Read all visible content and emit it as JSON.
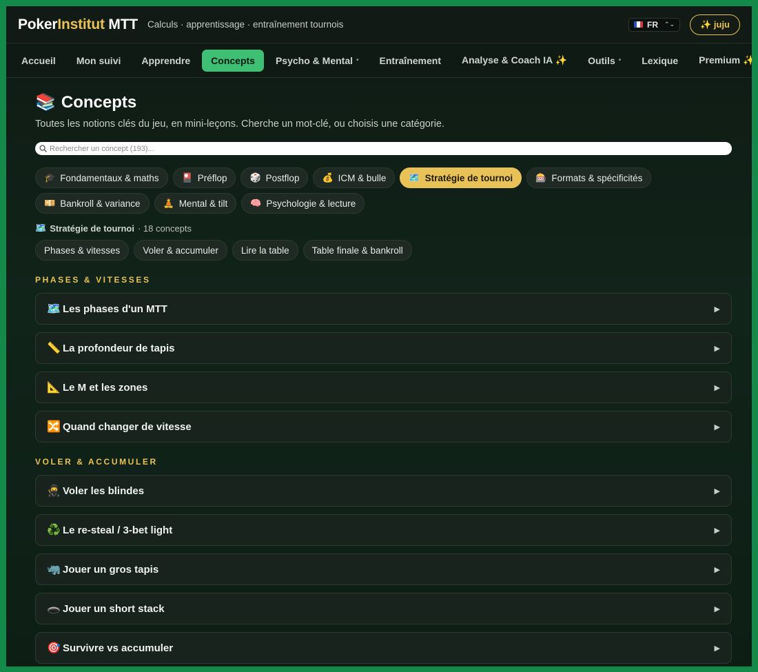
{
  "header": {
    "brand_part1": "Poker",
    "brand_part2": "Institut",
    "brand_part3": " MTT",
    "tagline": "Calculs · apprentissage · entraînement tournois",
    "language": "FR",
    "user_button": "✨ juju"
  },
  "nav": [
    {
      "label": "Accueil",
      "active": false,
      "dropdown": false
    },
    {
      "label": "Mon suivi",
      "active": false,
      "dropdown": false
    },
    {
      "label": "Apprendre",
      "active": false,
      "dropdown": false
    },
    {
      "label": "Concepts",
      "active": true,
      "dropdown": false
    },
    {
      "label": "Psycho & Mental",
      "active": false,
      "dropdown": true
    },
    {
      "label": "Entraînement",
      "active": false,
      "dropdown": false
    },
    {
      "label": "Analyse & Coach IA ✨",
      "active": false,
      "dropdown": false
    },
    {
      "label": "Outils",
      "active": false,
      "dropdown": true
    },
    {
      "label": "Lexique",
      "active": false,
      "dropdown": false
    },
    {
      "label": "Premium ✨",
      "active": false,
      "dropdown": false
    }
  ],
  "page": {
    "icon": "📚",
    "title": "Concepts",
    "subtitle": "Toutes les notions clés du jeu, en mini-leçons. Cherche un mot-clé, ou choisis une catégorie.",
    "search_placeholder": "Rechercher un concept (193)..."
  },
  "categories": [
    {
      "emoji": "🎓",
      "label": "Fondamentaux & maths",
      "active": false
    },
    {
      "emoji": "🎴",
      "label": "Préflop",
      "active": false
    },
    {
      "emoji": "🎲",
      "label": "Postflop",
      "active": false
    },
    {
      "emoji": "💰",
      "label": "ICM & bulle",
      "active": false
    },
    {
      "emoji": "🗺️",
      "label": "Stratégie de tournoi",
      "active": true
    },
    {
      "emoji": "🎰",
      "label": "Formats & spécificités",
      "active": false
    },
    {
      "emoji": "💴",
      "label": "Bankroll & variance",
      "active": false
    },
    {
      "emoji": "🧘",
      "label": "Mental & tilt",
      "active": false
    },
    {
      "emoji": "🧠",
      "label": "Psychologie & lecture",
      "active": false
    }
  ],
  "current_category": {
    "emoji": "🗺️",
    "name": "Stratégie de tournoi",
    "count": "· 18 concepts"
  },
  "subcategories": [
    "Phases & vitesses",
    "Voler & accumuler",
    "Lire la table",
    "Table finale & bankroll"
  ],
  "sections": [
    {
      "title": "Phases & vitesses",
      "concepts": [
        {
          "emoji": "🗺️",
          "title": "Les phases d'un MTT"
        },
        {
          "emoji": "📏",
          "title": "La profondeur de tapis"
        },
        {
          "emoji": "📐",
          "title": "Le M et les zones"
        },
        {
          "emoji": "🔀",
          "title": "Quand changer de vitesse"
        }
      ]
    },
    {
      "title": "Voler & accumuler",
      "concepts": [
        {
          "emoji": "🥷",
          "title": "Voler les blindes"
        },
        {
          "emoji": "♻️",
          "title": "Le re-steal / 3-bet light"
        },
        {
          "emoji": "🦏",
          "title": "Jouer un gros tapis"
        },
        {
          "emoji": "🕳️",
          "title": "Jouer un short stack"
        },
        {
          "emoji": "🎯",
          "title": "Survivre vs accumuler"
        }
      ]
    }
  ],
  "icons": {
    "expand": "▶"
  }
}
